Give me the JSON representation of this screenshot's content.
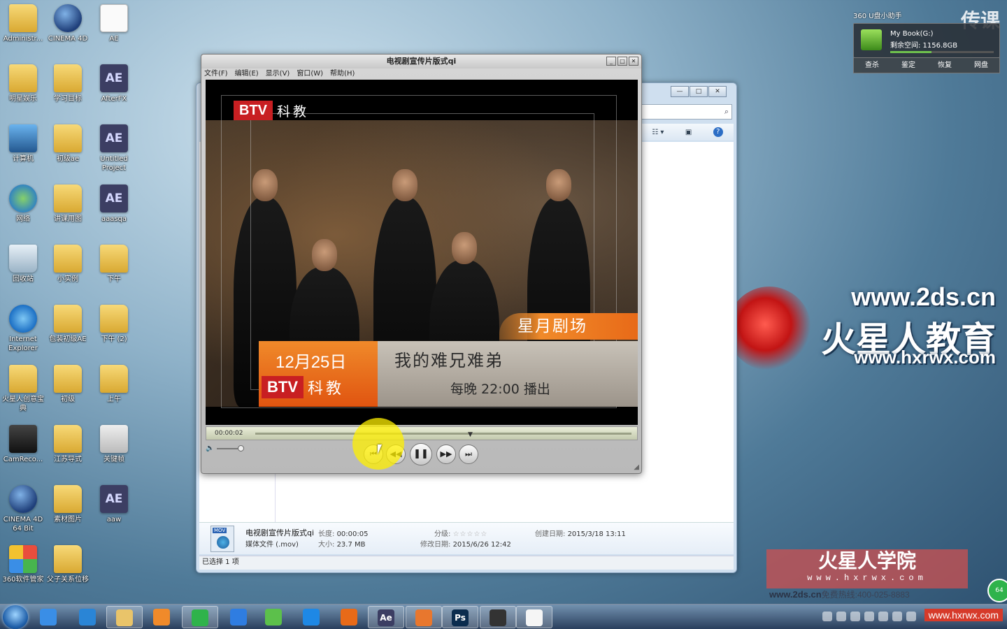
{
  "desktop": {
    "icons": [
      {
        "label": "Administr...",
        "type": "folder"
      },
      {
        "label": "CINEMA 4D",
        "type": "c4d"
      },
      {
        "label": "AE",
        "type": "doc"
      },
      {
        "label": "明星娱乐",
        "type": "folder"
      },
      {
        "label": "学习目标",
        "type": "folder"
      },
      {
        "label": "AfterFX",
        "type": "ae"
      },
      {
        "label": "计算机",
        "type": "pc"
      },
      {
        "label": "初级ae",
        "type": "folder"
      },
      {
        "label": "Untitled Project",
        "type": "ae"
      },
      {
        "label": "网络",
        "type": "net"
      },
      {
        "label": "讲课用图",
        "type": "folder"
      },
      {
        "label": "aaasqa",
        "type": "ae"
      },
      {
        "label": "回收站",
        "type": "bin"
      },
      {
        "label": "小实例",
        "type": "folder"
      },
      {
        "label": "下午",
        "type": "folder"
      },
      {
        "label": "Internet Explorer",
        "type": "ie"
      },
      {
        "label": "包装初级AE",
        "type": "folder"
      },
      {
        "label": "下午 (2)",
        "type": "folder"
      },
      {
        "label": "火星人创意宝典",
        "type": "folder"
      },
      {
        "label": "初级",
        "type": "folder"
      },
      {
        "label": "上午",
        "type": "folder"
      },
      {
        "label": "CamReco...",
        "type": "cam"
      },
      {
        "label": "江苏导式",
        "type": "folder"
      },
      {
        "label": "关键帧",
        "type": "app"
      },
      {
        "label": "CINEMA 4D 64 Bit",
        "type": "c4d"
      },
      {
        "label": "素材图片",
        "type": "folder"
      },
      {
        "label": "aaw",
        "type": "ae"
      },
      {
        "label": "360软件管家",
        "type": "k360"
      },
      {
        "label": "父子关系位移",
        "type": "folder"
      }
    ]
  },
  "usb_helper": {
    "title": "360 U盘小助手",
    "drive_name": "My Book(G:)",
    "free_space": "剩余空间: 1156.8GB",
    "actions": [
      "查杀",
      "鉴定",
      "恢复",
      "网盘"
    ]
  },
  "watermark": {
    "site1": "www.2ds.cn",
    "name": "火星人教育",
    "site2": "www.hxrwx.com",
    "stamp_title": "火星人学院",
    "stamp_url": "www.hxrwx.com",
    "bottom_site": "www.2ds.cn",
    "hotline": "免费热线:400-025-8883",
    "corner": "传课"
  },
  "player": {
    "title": "电视剧宣传片版式qi",
    "menu": [
      "文件(F)",
      "编辑(E)",
      "显示(V)",
      "窗口(W)",
      "帮助(H)"
    ],
    "video": {
      "channel_logo": "BTV",
      "channel_name": "科教",
      "program_tag": "星月剧场",
      "date": "12月25日",
      "show_title": "我的难兄难弟",
      "schedule": "每晚 22:00 播出"
    },
    "timecode": "00:00:02",
    "controls": {
      "prev": "⏮",
      "rewind": "◀◀",
      "pause": "❚❚",
      "forward": "▶▶",
      "next": "⏭"
    }
  },
  "explorer": {
    "details": {
      "filename": "电视剧宣传片版式qi",
      "filetype": "媒体文件 (.mov)",
      "length_label": "长度:",
      "length": "00:00:05",
      "size_label": "大小:",
      "size": "23.7 MB",
      "rating_label": "分级:",
      "modified_label": "修改日期:",
      "modified": "2015/6/26 12:42",
      "created_label": "创建日期:",
      "created": "2015/3/18 13:11",
      "thumb_badge": "MOV"
    },
    "status": "已选择 1 项"
  },
  "taskbar": {
    "site_url": "www.hxrwx.com",
    "apps": [
      "360",
      "ie",
      "explorer",
      "media",
      "360safe",
      "baidu",
      "player",
      "qq-player",
      "orange",
      "ae",
      "office",
      "ps",
      "camrec",
      "notepad"
    ]
  }
}
